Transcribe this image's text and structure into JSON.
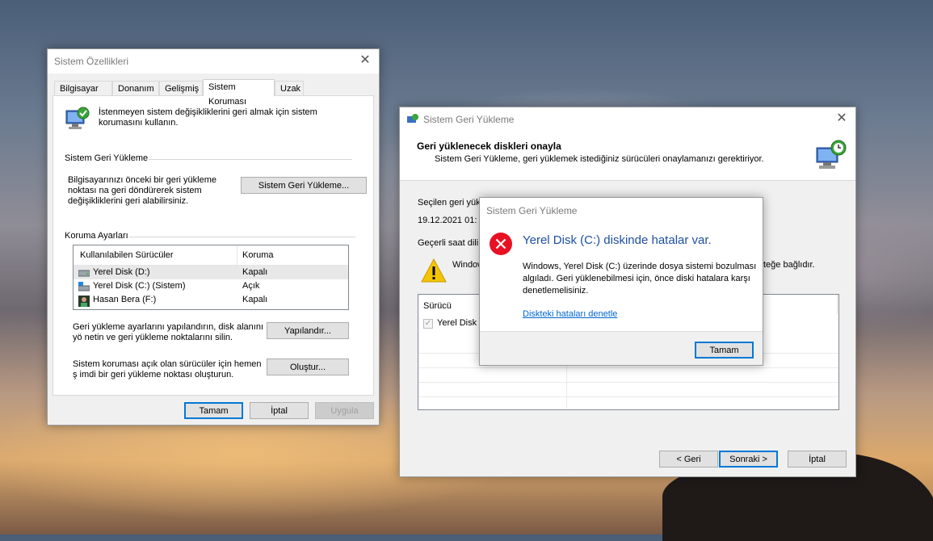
{
  "sysprops": {
    "title": "Sistem Özellikleri",
    "tabs": [
      "Bilgisayar Adı",
      "Donanım",
      "Gelişmiş",
      "Sistem Koruması",
      "Uzak"
    ],
    "intro": "İstenmeyen sistem değişikliklerini geri almak için sistem korumasını kullanın.",
    "restore_group": "Sistem Geri Yükleme",
    "restore_text": "Bilgisayarınızı önceki bir geri yükleme noktası na geri döndürerek sistem değişikliklerini geri alabilirsiniz.",
    "restore_button": "Sistem Geri Yükleme...",
    "protection_group": "Koruma Ayarları",
    "columns": [
      "Kullanılabilen Sürücüler",
      "Koruma"
    ],
    "drives": [
      {
        "name": "Yerel Disk (D:)",
        "status": "Kapalı",
        "icon": "drive-icon"
      },
      {
        "name": "Yerel Disk (C:) (Sistem)",
        "status": "Açık",
        "icon": "system-drive-icon"
      },
      {
        "name": "Hasan Bera (F:)",
        "status": "Kapalı",
        "icon": "user-drive-icon"
      }
    ],
    "configure_text": "Geri yükleme ayarlarını yapılandırın, disk alanını yö netin ve geri yükleme noktalarını silin.",
    "configure_button": "Yapılandır...",
    "create_text": "Sistem koruması açık olan sürücüler için hemen ş imdi bir geri yükleme noktası oluşturun.",
    "create_button": "Oluştur...",
    "ok": "Tamam",
    "cancel": "İptal",
    "apply": "Uygula"
  },
  "restore": {
    "title": "Sistem Geri Yükleme",
    "heading": "Geri yüklenecek diskleri onayla",
    "subheading": "Sistem Geri Yükleme, geri yüklemek istediğiniz sürücüleri onaylamanızı gerektiriyor.",
    "selected_label": "Seçilen geri yük",
    "selected_date": "19.12.2021 01:",
    "timezone_label": "Geçerli saat dilim",
    "warning_left": "Window",
    "warning_right": "teğe bağlıdır.",
    "drive_column": "Sürücü",
    "drive_item": "Yerel Disk (",
    "back": "< Geri",
    "next": "Sonraki >",
    "cancel": "İptal"
  },
  "error_dialog": {
    "title": "Sistem Geri Yükleme",
    "heading": "Yerel Disk (C:) diskinde hatalar var.",
    "body": "Windows, Yerel Disk (C:) üzerinde dosya sistemi bozulması algıladı. Geri yüklenebilmesi için, önce diski hatalara karşı denetlemelisiniz.",
    "link": "Diskteki hataları denetle",
    "ok": "Tamam"
  },
  "colors": {
    "accent": "#0078d7",
    "heading_blue": "#1e4fa0",
    "link": "#0066cc",
    "error_red": "#e81123",
    "warning_yellow": "#f5c400"
  }
}
